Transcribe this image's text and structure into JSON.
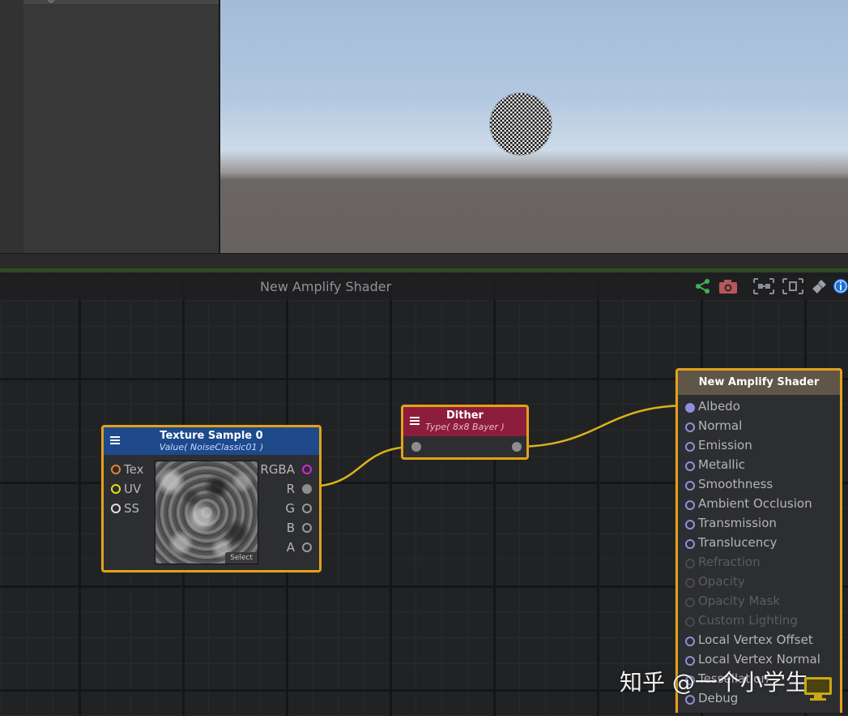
{
  "graph": {
    "title": "New Amplify Shader"
  },
  "toolbar": {
    "icons": [
      "share-icon",
      "camera-icon",
      "expand-node-icon",
      "focus-node-icon",
      "cleanup-brush-icon",
      "info-icon"
    ]
  },
  "texture_node": {
    "title": "Texture Sample 0",
    "subtitle": "Value( NoiseClassic01 )",
    "inputs": [
      {
        "label": "Tex",
        "color": "#e98426"
      },
      {
        "label": "UV",
        "color": "#dfe01a"
      },
      {
        "label": "SS",
        "color": "#e0e0e0"
      }
    ],
    "outputs": [
      "RGBA",
      "R",
      "G",
      "B",
      "A"
    ],
    "select_label": "Select"
  },
  "dither_node": {
    "title": "Dither",
    "subtitle": "Type( 8x8 Bayer )"
  },
  "master_node": {
    "title": "New Amplify Shader",
    "inputs": [
      {
        "label": "Albedo",
        "connected": true,
        "enabled": true
      },
      {
        "label": "Normal",
        "connected": false,
        "enabled": true
      },
      {
        "label": "Emission",
        "connected": false,
        "enabled": true
      },
      {
        "label": "Metallic",
        "connected": false,
        "enabled": true
      },
      {
        "label": "Smoothness",
        "connected": false,
        "enabled": true
      },
      {
        "label": "Ambient Occlusion",
        "connected": false,
        "enabled": true
      },
      {
        "label": "Transmission",
        "connected": false,
        "enabled": true
      },
      {
        "label": "Translucency",
        "connected": false,
        "enabled": true
      },
      {
        "label": "Refraction",
        "connected": false,
        "enabled": false
      },
      {
        "label": "Opacity",
        "connected": false,
        "enabled": false
      },
      {
        "label": "Opacity Mask",
        "connected": false,
        "enabled": false
      },
      {
        "label": "Custom Lighting",
        "connected": false,
        "enabled": false
      },
      {
        "label": "Local Vertex Offset",
        "connected": false,
        "enabled": true
      },
      {
        "label": "Local Vertex Normal",
        "connected": false,
        "enabled": true
      },
      {
        "label": "Tessellation",
        "connected": false,
        "enabled": true
      },
      {
        "label": "Debug",
        "connected": false,
        "enabled": true
      }
    ]
  },
  "colors": {
    "wire": "#d9b21c",
    "node_selected_border": "#e2a11b",
    "texture_header": "#1e4a8c",
    "dither_header": "#8c1d3c",
    "master_header": "#5f5648",
    "rgba_port": "#d826d8"
  },
  "watermark": "知乎 @一个小学生"
}
